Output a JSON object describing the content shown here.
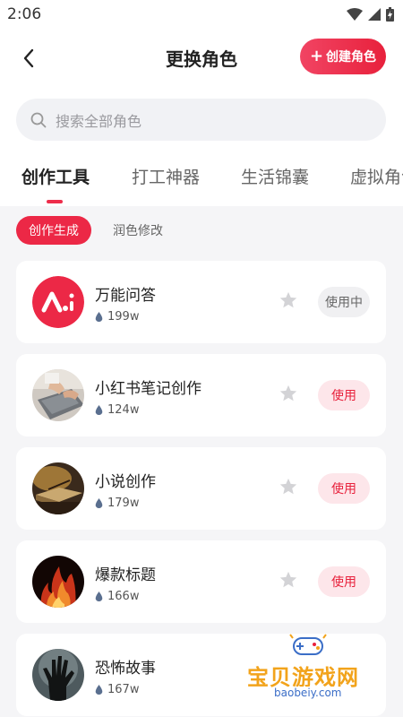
{
  "status_bar": {
    "time": "2:06"
  },
  "header": {
    "title": "更换角色",
    "create_label": "创建角色"
  },
  "search": {
    "placeholder": "搜索全部角色"
  },
  "tabs": [
    {
      "label": "创作工具",
      "active": true
    },
    {
      "label": "打工神器",
      "active": false
    },
    {
      "label": "生活锦囊",
      "active": false
    },
    {
      "label": "虚拟角色",
      "active": false
    }
  ],
  "chips": [
    {
      "label": "创作生成",
      "active": true
    },
    {
      "label": "润色修改",
      "active": false
    }
  ],
  "roles": [
    {
      "name": "万能问答",
      "count": "199w",
      "action": "使用中"
    },
    {
      "name": "小红书笔记创作",
      "count": "124w",
      "action": "使用"
    },
    {
      "name": "小说创作",
      "count": "179w",
      "action": "使用"
    },
    {
      "name": "爆款标题",
      "count": "166w",
      "action": "使用"
    },
    {
      "name": "恐怖故事",
      "count": "167w",
      "action": "使用"
    }
  ],
  "watermark": {
    "text": "宝贝游戏网",
    "url": "baobeiy.com"
  },
  "colors": {
    "accent": "#ec2846",
    "accent_light": "#fde6ea",
    "background": "#f5f5f7"
  }
}
